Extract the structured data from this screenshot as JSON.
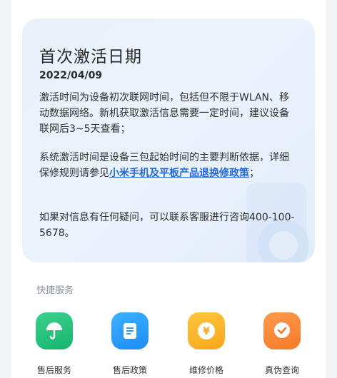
{
  "activation": {
    "title": "首次激活日期",
    "date": "2022/04/09",
    "para1": "激活时间为设备初次联网时间，包括但不限于WLAN、移动数据网络。新机获取激活信息需要一定时间，建议设备联网后3~5天查看；",
    "para2_text": "系统激活时间是设备三包起始时间的主要判断依据，详细保修规则请参见",
    "para2_link": "小米手机及平板产品退换修政策",
    "para2_end": "；",
    "para3": "如果对信息有任何疑问，可以联系客服进行咨询400-100-5678。"
  },
  "quick_services": {
    "title": "快捷服务",
    "items": [
      {
        "label": "售后服务",
        "icon": "umbrella-icon",
        "color": "#1fbf79"
      },
      {
        "label": "售后政策",
        "icon": "document-icon",
        "color": "#2a9cfa"
      },
      {
        "label": "维修价格",
        "icon": "yuan-coin-icon",
        "color": "#f9b42a"
      },
      {
        "label": "真伪查询",
        "icon": "verify-badge-icon",
        "color": "#f5843a"
      }
    ]
  }
}
